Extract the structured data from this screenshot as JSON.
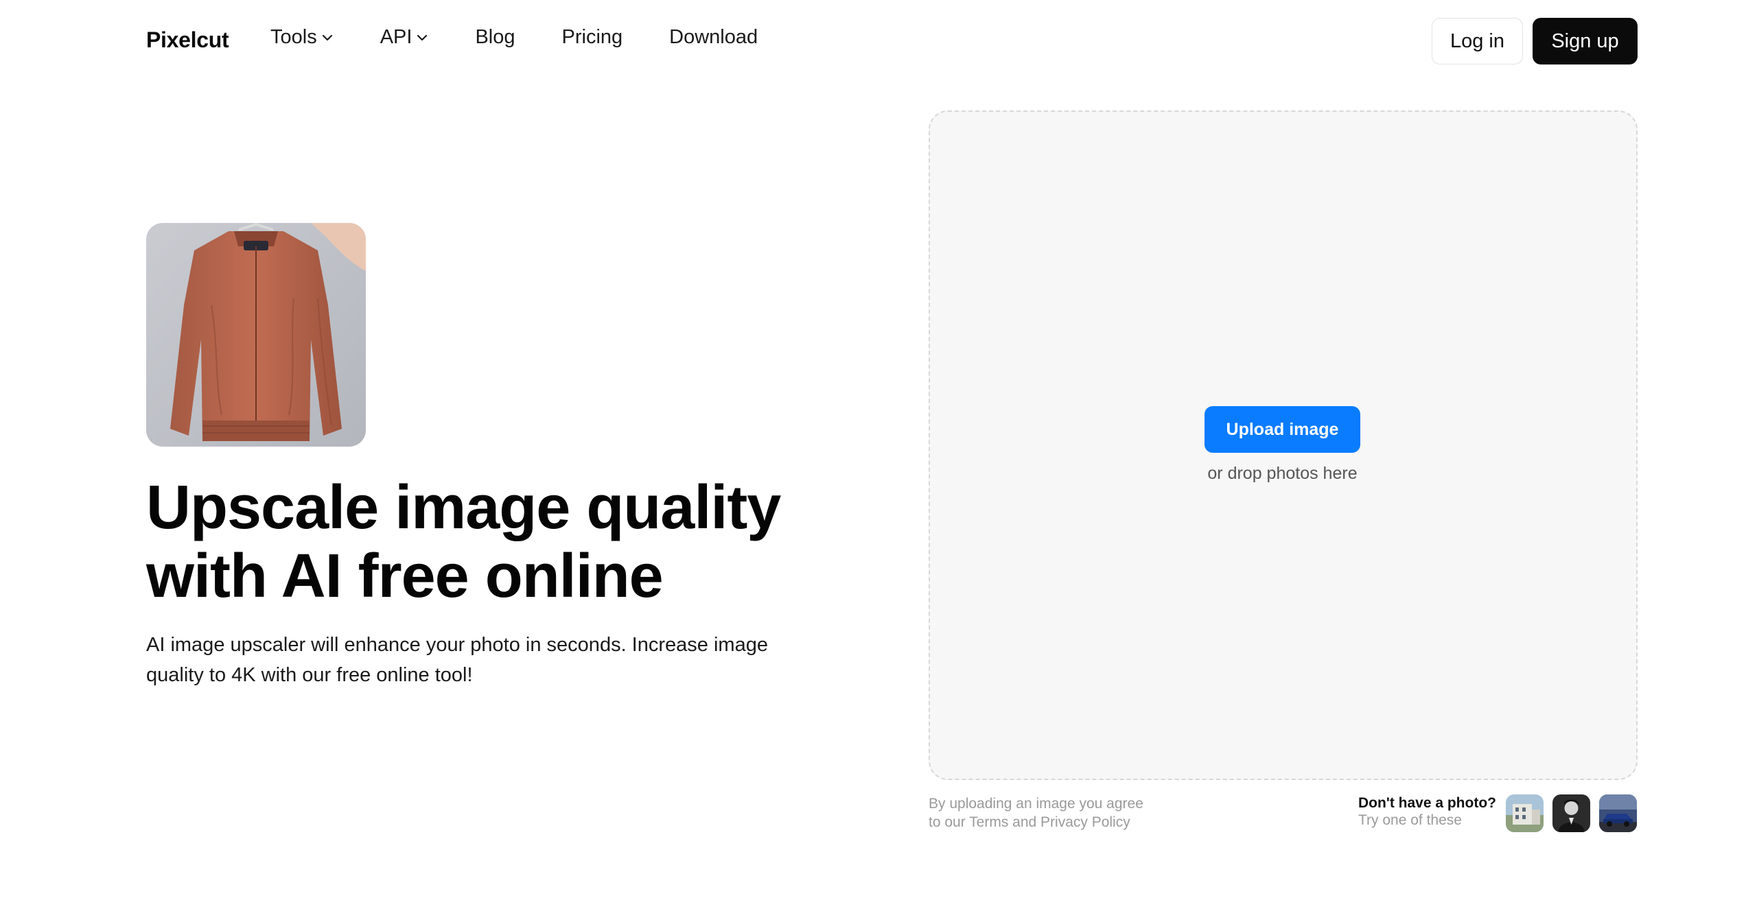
{
  "header": {
    "logo": "Pixelcut",
    "nav": [
      {
        "label": "Tools",
        "has_dropdown": true
      },
      {
        "label": "API",
        "has_dropdown": true
      },
      {
        "label": "Blog",
        "has_dropdown": false
      },
      {
        "label": "Pricing",
        "has_dropdown": false
      },
      {
        "label": "Download",
        "has_dropdown": false
      }
    ],
    "login_label": "Log in",
    "signup_label": "Sign up"
  },
  "hero": {
    "title_line1": "Upscale image quality",
    "title_line2": "with AI free online",
    "subtitle_line1": "AI image upscaler will enhance your photo in seconds. Increase image",
    "subtitle_line2": "quality to 4K with our free online tool!"
  },
  "upload": {
    "button_label": "Upload image",
    "drop_hint": "or drop photos here",
    "terms_line1": "By uploading an image you agree",
    "terms_line2": "to our Terms and Privacy Policy",
    "sample_title": "Don't have a photo?",
    "sample_sub": "Try one of these"
  },
  "colors": {
    "accent": "#0a7cff",
    "signup_bg": "#0b0b0b",
    "drop_bg": "#f7f7f7"
  },
  "icons": {
    "dropdown": "chevron-down-icon"
  }
}
